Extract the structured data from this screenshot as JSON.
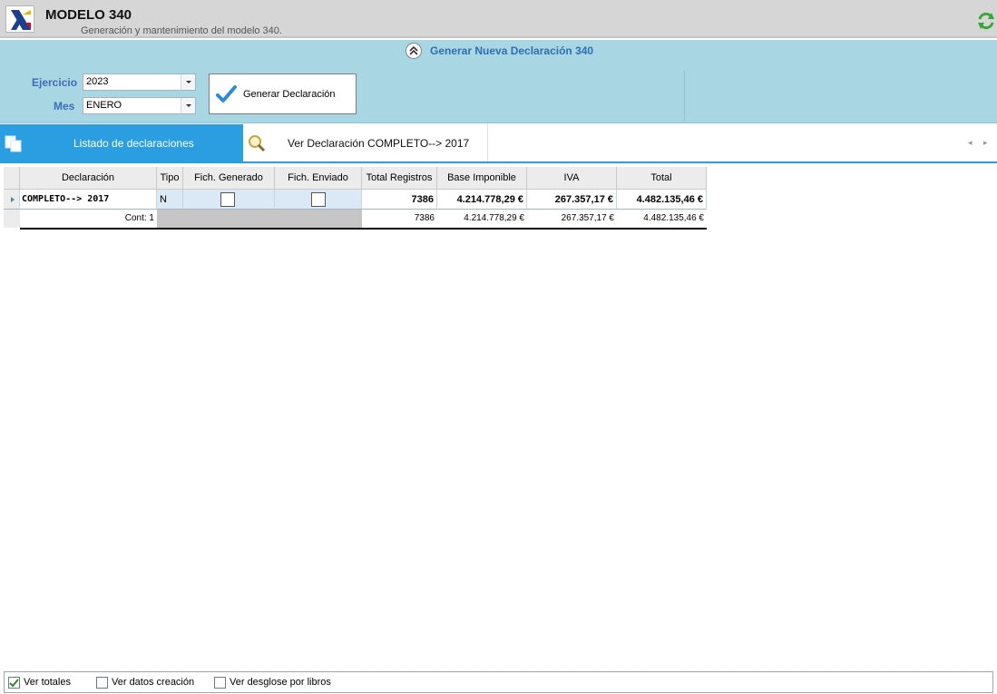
{
  "header": {
    "title": "MODELO 340",
    "subtitle": "Generación y mantenimiento del modelo 340."
  },
  "generate_panel": {
    "toggle_label": "Generar Nueva Declaración 340",
    "ejercicio_label": "Ejercicio",
    "ejercicio_value": "2023",
    "mes_label": "Mes",
    "mes_value": "ENERO",
    "generate_button_label": "Generar Declaración"
  },
  "tabs": [
    {
      "label": "Listado de declaraciones",
      "active": true
    },
    {
      "label": "Ver Declaración COMPLETO--> 2017",
      "active": false
    }
  ],
  "grid": {
    "columns": [
      "Declaración",
      "Tipo",
      "Fich. Generado",
      "Fich. Enviado",
      "Total Registros",
      "Base Imponible",
      "IVA",
      "Total"
    ],
    "row": {
      "declaracion": "COMPLETO--> 2017",
      "tipo": "N",
      "fich_generado": false,
      "fich_enviado": false,
      "total_registros": "7386",
      "base_imponible": "4.214.778,29 €",
      "iva": "267.357,17 €",
      "total": "4.482.135,46 €"
    },
    "footer": {
      "count": "Cont: 1",
      "total_registros": "7386",
      "base_imponible": "4.214.778,29 €",
      "iva": "267.357,17 €",
      "total": "4.482.135,46 €"
    }
  },
  "options": [
    {
      "label": "Ver totales",
      "checked": true
    },
    {
      "label": "Ver datos creación",
      "checked": false
    },
    {
      "label": "Ver desglose por libros",
      "checked": false
    }
  ],
  "colors": {
    "panel_bg": "#a9d6e3",
    "accent": "#2a9ee0",
    "label_blue": "#3a6db8"
  }
}
